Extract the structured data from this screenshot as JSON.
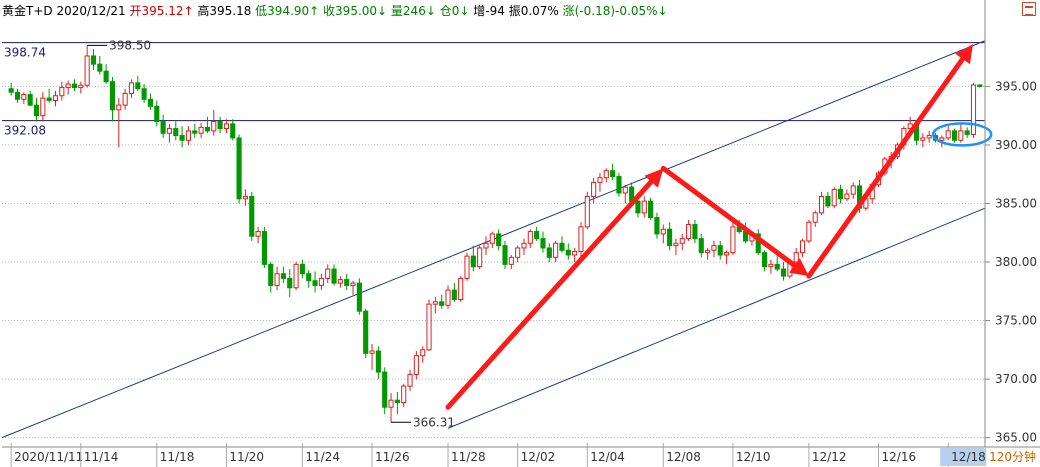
{
  "header": {
    "name": "黄金T+D",
    "date": "2020/12/21",
    "open": "开395.12↑",
    "high": "高395.18",
    "low": "低394.90↑",
    "close": "收395.00↓",
    "volume": "量246↓",
    "position": "仓0↓",
    "increase": "增-94",
    "amplitude": "振0.07%",
    "change": "涨(-0.18)-0.05%↓"
  },
  "period_label": "120分钟",
  "colors": {
    "up": "#e02020",
    "down": "#009900",
    "arrow": "#ff1a1a",
    "channel": "#1a3a8a",
    "ellipse": "#1e90ff",
    "grid": "#b8b8b8"
  },
  "chart_data": {
    "type": "candlestick",
    "x_ticks": [
      "2020/11/11",
      "11/14",
      "11/18",
      "11/20",
      "11/24",
      "11/26",
      "11/28",
      "12/02",
      "12/04",
      "12/08",
      "12/10",
      "12/12",
      "12/16",
      "12/18"
    ],
    "y_ticks": [
      395.0,
      390.0,
      385.0,
      380.0,
      375.0,
      370.0,
      365.0
    ],
    "ylim": [
      364.2,
      400.5
    ],
    "highlighted_price": "395.00",
    "annotations": [
      {
        "label": "398.74",
        "value": 398.74
      },
      {
        "label": "398.50",
        "value": 398.5
      },
      {
        "label": "392.08",
        "value": 392.08
      },
      {
        "label": "366.31",
        "value": 366.31
      }
    ],
    "horizontal_lines": [
      398.74,
      392.08
    ],
    "candles": [
      [
        394.8,
        395.3,
        394.2,
        394.5
      ],
      [
        394.5,
        394.8,
        393.6,
        393.9
      ],
      [
        393.9,
        394.5,
        393.5,
        394.3
      ],
      [
        394.3,
        394.6,
        393.3,
        393.4
      ],
      [
        393.4,
        394.0,
        392.0,
        392.5
      ],
      [
        392.5,
        394.5,
        392.0,
        394.0
      ],
      [
        394.0,
        394.8,
        393.6,
        393.8
      ],
      [
        393.8,
        394.6,
        393.3,
        394.2
      ],
      [
        394.2,
        395.4,
        393.8,
        394.9
      ],
      [
        394.9,
        395.5,
        394.3,
        395.2
      ],
      [
        395.2,
        395.6,
        394.6,
        394.9
      ],
      [
        394.9,
        395.4,
        394.4,
        395.1
      ],
      [
        395.1,
        398.5,
        394.9,
        397.6
      ],
      [
        397.6,
        398.2,
        396.4,
        396.9
      ],
      [
        396.9,
        397.6,
        396.0,
        396.3
      ],
      [
        396.3,
        396.9,
        395.2,
        395.4
      ],
      [
        395.4,
        395.8,
        392.0,
        393.0
      ],
      [
        393.0,
        394.0,
        389.8,
        393.4
      ],
      [
        393.4,
        394.8,
        393.0,
        394.4
      ],
      [
        394.4,
        395.6,
        394.0,
        395.3
      ],
      [
        395.3,
        395.9,
        394.6,
        394.8
      ],
      [
        394.8,
        395.2,
        393.6,
        393.9
      ],
      [
        393.9,
        394.4,
        393.0,
        393.3
      ],
      [
        393.3,
        393.8,
        391.6,
        392.0
      ],
      [
        392.0,
        392.6,
        390.6,
        391.0
      ],
      [
        391.0,
        391.8,
        390.2,
        391.4
      ],
      [
        391.4,
        392.0,
        390.4,
        390.8
      ],
      [
        390.8,
        391.6,
        389.8,
        390.4
      ],
      [
        390.4,
        391.6,
        390.0,
        391.2
      ],
      [
        391.2,
        391.8,
        390.6,
        391.0
      ],
      [
        391.0,
        391.9,
        390.6,
        391.5
      ],
      [
        391.5,
        392.4,
        391.0,
        391.2
      ],
      [
        391.2,
        393.0,
        390.8,
        392.0
      ],
      [
        392.0,
        392.4,
        391.0,
        391.4
      ],
      [
        391.4,
        392.2,
        391.0,
        391.8
      ],
      [
        391.8,
        392.2,
        390.4,
        390.6
      ],
      [
        390.6,
        390.9,
        385.0,
        385.4
      ],
      [
        385.4,
        386.2,
        384.8,
        385.6
      ],
      [
        385.6,
        386.0,
        381.8,
        382.2
      ],
      [
        382.2,
        383.0,
        381.6,
        382.6
      ],
      [
        382.6,
        383.0,
        379.5,
        379.8
      ],
      [
        379.8,
        380.0,
        377.4,
        378.0
      ],
      [
        378.0,
        379.6,
        377.6,
        379.0
      ],
      [
        379.0,
        379.6,
        378.2,
        378.6
      ],
      [
        378.6,
        379.4,
        377.0,
        377.8
      ],
      [
        377.8,
        380.0,
        377.6,
        379.8
      ],
      [
        379.8,
        380.2,
        378.6,
        379.0
      ],
      [
        379.0,
        379.3,
        377.8,
        378.4
      ],
      [
        378.4,
        379.2,
        377.4,
        378.0
      ],
      [
        378.0,
        379.0,
        377.6,
        378.6
      ],
      [
        378.6,
        379.8,
        378.2,
        379.4
      ],
      [
        379.4,
        379.8,
        378.0,
        378.2
      ],
      [
        378.2,
        378.8,
        377.8,
        378.5
      ],
      [
        378.5,
        379.0,
        377.6,
        378.0
      ],
      [
        378.0,
        378.4,
        377.2,
        378.2
      ],
      [
        378.2,
        378.6,
        375.5,
        375.8
      ],
      [
        375.8,
        376.0,
        371.8,
        372.2
      ],
      [
        372.2,
        373.0,
        370.8,
        372.4
      ],
      [
        372.4,
        372.8,
        370.0,
        370.6
      ],
      [
        370.6,
        371.0,
        367.0,
        367.6
      ],
      [
        367.6,
        368.8,
        366.31,
        368.2
      ],
      [
        368.2,
        368.9,
        367.0,
        368.0
      ],
      [
        368.0,
        369.6,
        367.6,
        369.4
      ],
      [
        369.4,
        370.8,
        369.0,
        370.4
      ],
      [
        370.4,
        372.4,
        370.0,
        372.0
      ],
      [
        372.0,
        372.8,
        371.4,
        372.5
      ],
      [
        372.5,
        376.8,
        372.4,
        376.4
      ],
      [
        376.4,
        377.0,
        375.6,
        376.6
      ],
      [
        376.6,
        377.2,
        376.0,
        376.3
      ],
      [
        376.3,
        378.0,
        376.0,
        377.6
      ],
      [
        377.6,
        378.2,
        376.6,
        376.8
      ],
      [
        376.8,
        378.8,
        376.6,
        378.6
      ],
      [
        378.6,
        380.8,
        378.4,
        380.5
      ],
      [
        380.5,
        381.4,
        379.2,
        379.6
      ],
      [
        379.6,
        381.4,
        379.4,
        381.2
      ],
      [
        381.2,
        382.2,
        380.6,
        381.6
      ],
      [
        381.6,
        382.6,
        381.2,
        382.4
      ],
      [
        382.4,
        382.8,
        381.0,
        381.4
      ],
      [
        381.4,
        381.8,
        379.4,
        379.8
      ],
      [
        379.8,
        380.6,
        379.4,
        380.4
      ],
      [
        380.4,
        381.4,
        380.0,
        381.2
      ],
      [
        381.2,
        382.0,
        380.6,
        381.6
      ],
      [
        381.6,
        382.8,
        381.2,
        382.6
      ],
      [
        382.6,
        383.0,
        381.8,
        382.0
      ],
      [
        382.0,
        382.6,
        380.8,
        381.2
      ],
      [
        381.2,
        381.6,
        380.0,
        380.4
      ],
      [
        380.4,
        381.8,
        380.0,
        381.6
      ],
      [
        381.6,
        382.2,
        380.8,
        381.0
      ],
      [
        381.0,
        381.6,
        380.2,
        380.6
      ],
      [
        380.6,
        381.2,
        380.0,
        380.9
      ],
      [
        380.9,
        383.4,
        380.4,
        383.0
      ],
      [
        383.0,
        386.0,
        382.8,
        385.6
      ],
      [
        385.6,
        387.2,
        385.0,
        386.8
      ],
      [
        386.8,
        387.6,
        386.0,
        387.2
      ],
      [
        387.2,
        388.0,
        386.8,
        387.8
      ],
      [
        387.8,
        388.4,
        387.0,
        387.3
      ],
      [
        387.3,
        387.6,
        385.6,
        385.9
      ],
      [
        385.9,
        386.6,
        385.0,
        386.4
      ],
      [
        386.4,
        386.8,
        384.8,
        385.2
      ],
      [
        385.2,
        385.6,
        383.8,
        384.2
      ],
      [
        384.2,
        385.6,
        383.8,
        385.2
      ],
      [
        385.2,
        385.5,
        383.6,
        383.8
      ],
      [
        383.8,
        384.2,
        382.0,
        382.4
      ],
      [
        382.4,
        383.2,
        381.6,
        382.8
      ],
      [
        382.8,
        383.4,
        381.0,
        381.4
      ],
      [
        381.4,
        382.0,
        380.6,
        381.6
      ],
      [
        381.6,
        382.4,
        381.0,
        382.0
      ],
      [
        382.0,
        383.6,
        381.8,
        383.2
      ],
      [
        383.2,
        383.6,
        381.6,
        382.0
      ],
      [
        382.0,
        382.4,
        380.4,
        380.8
      ],
      [
        380.8,
        381.2,
        380.2,
        381.0
      ],
      [
        381.0,
        381.8,
        380.4,
        381.4
      ],
      [
        381.4,
        381.8,
        380.2,
        380.6
      ],
      [
        380.6,
        381.0,
        379.8,
        380.8
      ],
      [
        380.8,
        383.4,
        380.6,
        383.0
      ],
      [
        383.0,
        383.6,
        382.4,
        382.6
      ],
      [
        382.6,
        383.4,
        381.6,
        381.8
      ],
      [
        381.8,
        382.6,
        381.4,
        382.4
      ],
      [
        382.4,
        382.8,
        380.6,
        380.8
      ],
      [
        380.8,
        381.0,
        379.2,
        379.6
      ],
      [
        379.6,
        380.2,
        379.0,
        379.8
      ],
      [
        379.8,
        380.6,
        379.2,
        379.4
      ],
      [
        379.4,
        380.0,
        378.4,
        378.8
      ],
      [
        378.8,
        380.2,
        378.6,
        380.0
      ],
      [
        380.0,
        381.2,
        379.6,
        380.8
      ],
      [
        380.8,
        382.0,
        380.4,
        381.8
      ],
      [
        381.8,
        383.6,
        381.6,
        383.4
      ],
      [
        383.4,
        384.4,
        383.0,
        384.2
      ],
      [
        384.2,
        386.0,
        384.0,
        385.6
      ],
      [
        385.6,
        386.0,
        384.6,
        384.8
      ],
      [
        384.8,
        386.4,
        384.6,
        386.2
      ],
      [
        386.2,
        386.6,
        385.0,
        385.4
      ],
      [
        385.4,
        386.2,
        385.2,
        385.8
      ],
      [
        385.8,
        386.8,
        385.4,
        386.5
      ],
      [
        386.5,
        387.0,
        384.2,
        384.6
      ],
      [
        384.6,
        385.6,
        384.4,
        385.4
      ],
      [
        385.4,
        386.8,
        385.0,
        386.6
      ],
      [
        386.6,
        387.8,
        386.4,
        387.6
      ],
      [
        387.6,
        389.0,
        387.4,
        388.8
      ],
      [
        388.8,
        389.4,
        388.0,
        389.0
      ],
      [
        389.0,
        390.2,
        388.8,
        390.0
      ],
      [
        390.0,
        391.6,
        389.6,
        391.4
      ],
      [
        391.4,
        392.4,
        391.0,
        391.8
      ],
      [
        391.8,
        392.0,
        390.0,
        390.4
      ],
      [
        390.4,
        391.0,
        389.8,
        390.6
      ],
      [
        390.6,
        391.2,
        390.2,
        390.8
      ],
      [
        390.8,
        391.0,
        390.2,
        390.4
      ],
      [
        390.4,
        390.8,
        389.8,
        390.6
      ],
      [
        390.6,
        391.6,
        390.4,
        391.2
      ],
      [
        391.2,
        391.4,
        390.2,
        390.4
      ],
      [
        390.4,
        391.8,
        390.2,
        391.2
      ],
      [
        391.2,
        391.5,
        390.6,
        390.9
      ],
      [
        390.9,
        395.3,
        390.6,
        395.12
      ],
      [
        395.12,
        395.18,
        394.9,
        395.0
      ]
    ],
    "channel_lines": [
      {
        "from": [
          "start",
          365.0
        ],
        "to": [
          "end",
          398.9
        ]
      },
      {
        "from": [
          "11/28",
          365.8
        ],
        "to": [
          "end",
          384.6
        ]
      }
    ],
    "arrows": [
      {
        "from": [
          "11/28",
          367.6
        ],
        "to": [
          "12/08",
          388.0
        ]
      },
      {
        "from": [
          "12/08",
          388.0
        ],
        "to": [
          "12/12",
          378.8
        ]
      },
      {
        "from": [
          "12/12",
          378.8
        ],
        "to": [
          "end",
          398.6
        ]
      }
    ],
    "ellipse": {
      "center": [
        "12/18",
        390.9
      ]
    }
  }
}
